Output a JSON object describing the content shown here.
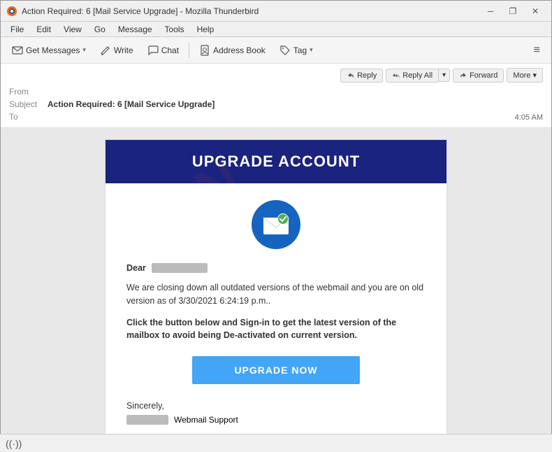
{
  "window": {
    "title": "Action Required: 6 [Mail Service Upgrade] - Mozilla Thunderbird",
    "icon": "thunderbird"
  },
  "titlebar": {
    "minimize_label": "─",
    "restore_label": "❐",
    "close_label": "✕"
  },
  "menubar": {
    "items": [
      "File",
      "Edit",
      "View",
      "Go",
      "Message",
      "Tools",
      "Help"
    ]
  },
  "toolbar": {
    "get_messages_label": "Get Messages",
    "write_label": "Write",
    "chat_label": "Chat",
    "address_book_label": "Address Book",
    "tag_label": "Tag",
    "hamburger_label": "≡"
  },
  "email_header": {
    "from_label": "From",
    "subject_label": "Subject",
    "to_label": "To",
    "subject_value": "Action Required: 6 [Mail Service Upgrade]",
    "time": "4:05 AM",
    "reply_label": "Reply",
    "reply_all_label": "Reply All",
    "forward_label": "Forward",
    "more_label": "More"
  },
  "email_body": {
    "header_title": "UPGRADE ACCOUNT",
    "dear_prefix": "Dear",
    "paragraph1": "We are closing down all outdated versions of the webmail and you are on old version as of 3/30/2021 6:24:19 p.m..",
    "paragraph2": "Click the button below and Sign-in to get the latest version of the mailbox to avoid being De-activated on current version.",
    "upgrade_button": "UPGRADE NOW",
    "sincerely": "Sincerely,",
    "sender_suffix": "Webmail Support"
  },
  "statusbar": {
    "icon": "((·))"
  }
}
